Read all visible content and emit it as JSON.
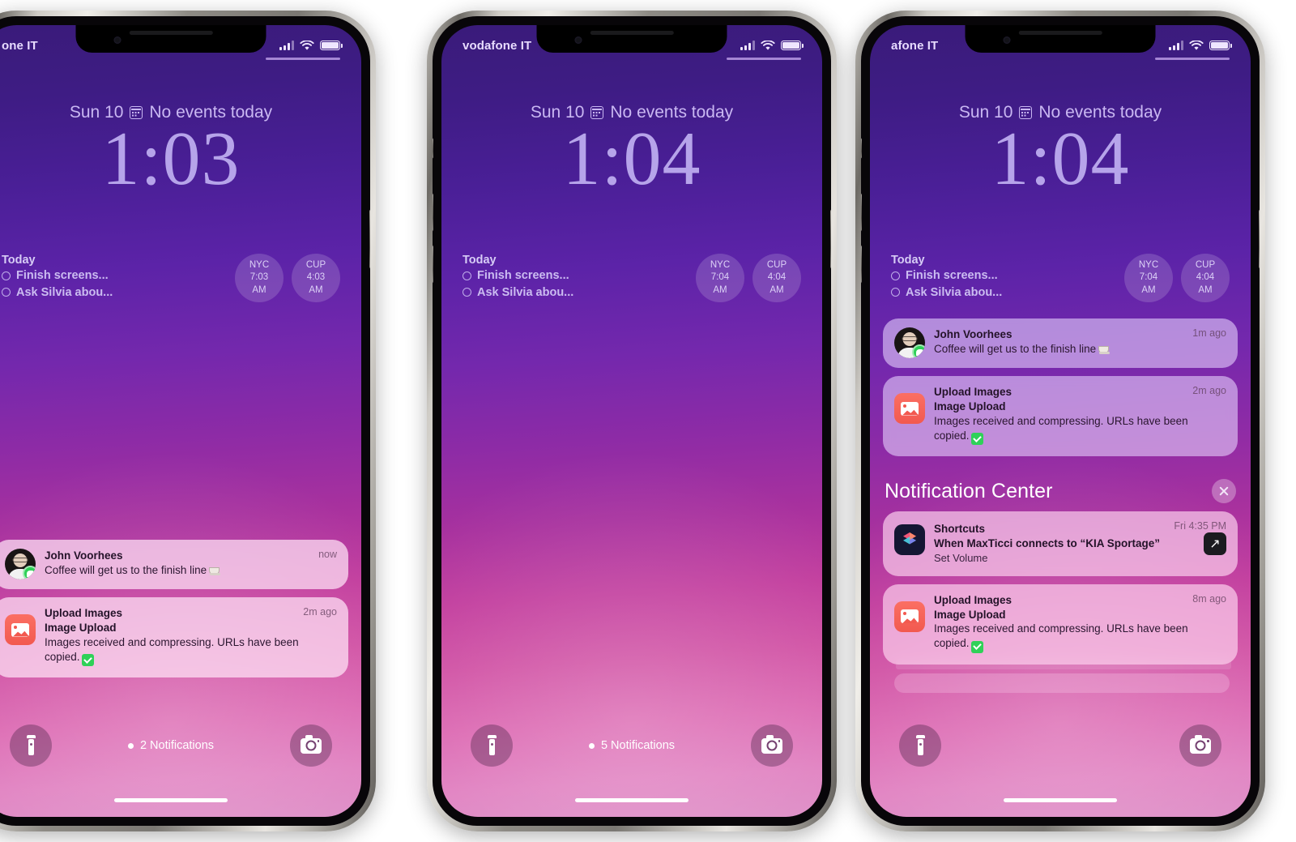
{
  "phones": [
    {
      "id": "phone-1",
      "status": {
        "carrier": "one IT",
        "signal_icon": "cellular-bars-icon",
        "wifi_icon": "wifi-icon",
        "battery_icon": "battery-icon"
      },
      "lock": {
        "date": "Sun 10",
        "calendar_icon": "calendar-icon",
        "events": "No events today",
        "time": "1:03"
      },
      "widgets": {
        "reminders": {
          "title": "Today",
          "items": [
            "Finish screens...",
            "Ask Silvia abou..."
          ]
        },
        "clocks": [
          {
            "city": "NYC",
            "time": "7:03",
            "period": "AM"
          },
          {
            "city": "CUP",
            "time": "4:03",
            "period": "AM"
          }
        ]
      },
      "notifications": [
        {
          "style": "light",
          "icon": "contact-avatar",
          "app": "John Voorhees",
          "title": "",
          "text": "Coffee will get us to the finish line",
          "emoji": "coffee",
          "sub": "",
          "time": "now",
          "badge": "messages-badge-icon"
        },
        {
          "style": "light",
          "icon": "upload-images-icon",
          "app": "Upload Images",
          "title": "Image Upload",
          "text": "Images received and compressing. URLs have been copied.",
          "emoji": "check",
          "sub": "",
          "time": "2m ago"
        }
      ],
      "bottom": {
        "flashlight_icon": "flashlight-icon",
        "camera_icon": "camera-icon",
        "notification_count": "2 Notifications"
      }
    },
    {
      "id": "phone-2",
      "status": {
        "carrier": "vodafone IT",
        "signal_icon": "cellular-bars-icon",
        "wifi_icon": "wifi-icon",
        "battery_icon": "battery-icon"
      },
      "lock": {
        "date": "Sun 10",
        "calendar_icon": "calendar-icon",
        "events": "No events today",
        "time": "1:04"
      },
      "widgets": {
        "reminders": {
          "title": "Today",
          "items": [
            "Finish screens...",
            "Ask Silvia abou..."
          ]
        },
        "clocks": [
          {
            "city": "NYC",
            "time": "7:04",
            "period": "AM"
          },
          {
            "city": "CUP",
            "time": "4:04",
            "period": "AM"
          }
        ]
      },
      "notifications": [],
      "bottom": {
        "flashlight_icon": "flashlight-icon",
        "camera_icon": "camera-icon",
        "notification_count": "5 Notifications"
      }
    },
    {
      "id": "phone-3",
      "status": {
        "carrier": "afone IT",
        "signal_icon": "cellular-bars-icon",
        "wifi_icon": "wifi-icon",
        "battery_icon": "battery-icon"
      },
      "lock": {
        "date": "Sun 10",
        "calendar_icon": "calendar-icon",
        "events": "No events today",
        "time": "1:04"
      },
      "widgets": {
        "reminders": {
          "title": "Today",
          "items": [
            "Finish screens...",
            "Ask Silvia abou..."
          ]
        },
        "clocks": [
          {
            "city": "NYC",
            "time": "7:04",
            "period": "AM"
          },
          {
            "city": "CUP",
            "time": "4:04",
            "period": "AM"
          }
        ]
      },
      "notifications": [
        {
          "style": "lilac",
          "icon": "contact-avatar",
          "app": "John Voorhees",
          "title": "",
          "text": "Coffee will get us to the finish line",
          "emoji": "coffee",
          "sub": "",
          "time": "1m ago",
          "badge": "messages-badge-icon"
        },
        {
          "style": "lilac",
          "icon": "upload-images-icon",
          "app": "Upload Images",
          "title": "Image Upload",
          "text": "Images received and compressing. URLs have been copied.",
          "emoji": "check",
          "sub": "",
          "time": "2m ago"
        }
      ],
      "notification_center": {
        "title": "Notification Center",
        "close_icon": "close-icon",
        "notifications": [
          {
            "style": "pinker",
            "icon": "shortcuts-icon",
            "app": "Shortcuts",
            "title": "When MaxTicci connects to “KIA Sportage”",
            "sub": "Set Volume",
            "text": "",
            "emoji": "",
            "time": "Fri 4:35 PM",
            "action_icon": "open-arrow-icon"
          },
          {
            "style": "pinker",
            "icon": "upload-images-icon",
            "app": "Upload Images",
            "title": "Image Upload",
            "text": "Images received and compressing. URLs have been copied.",
            "emoji": "check",
            "sub": "",
            "time": "8m ago"
          }
        ]
      },
      "bottom": {
        "flashlight_icon": "flashlight-icon",
        "camera_icon": "camera-icon",
        "notification_count": ""
      }
    }
  ],
  "colors": {
    "wallpaper_top": "#3a1b7a",
    "wallpaper_bottom": "#dd8bc5",
    "clock_text": "#b6a4ea",
    "accent_green": "#2fd158",
    "upload_icon": "#f2594f",
    "shortcuts_icon": "#141633"
  }
}
